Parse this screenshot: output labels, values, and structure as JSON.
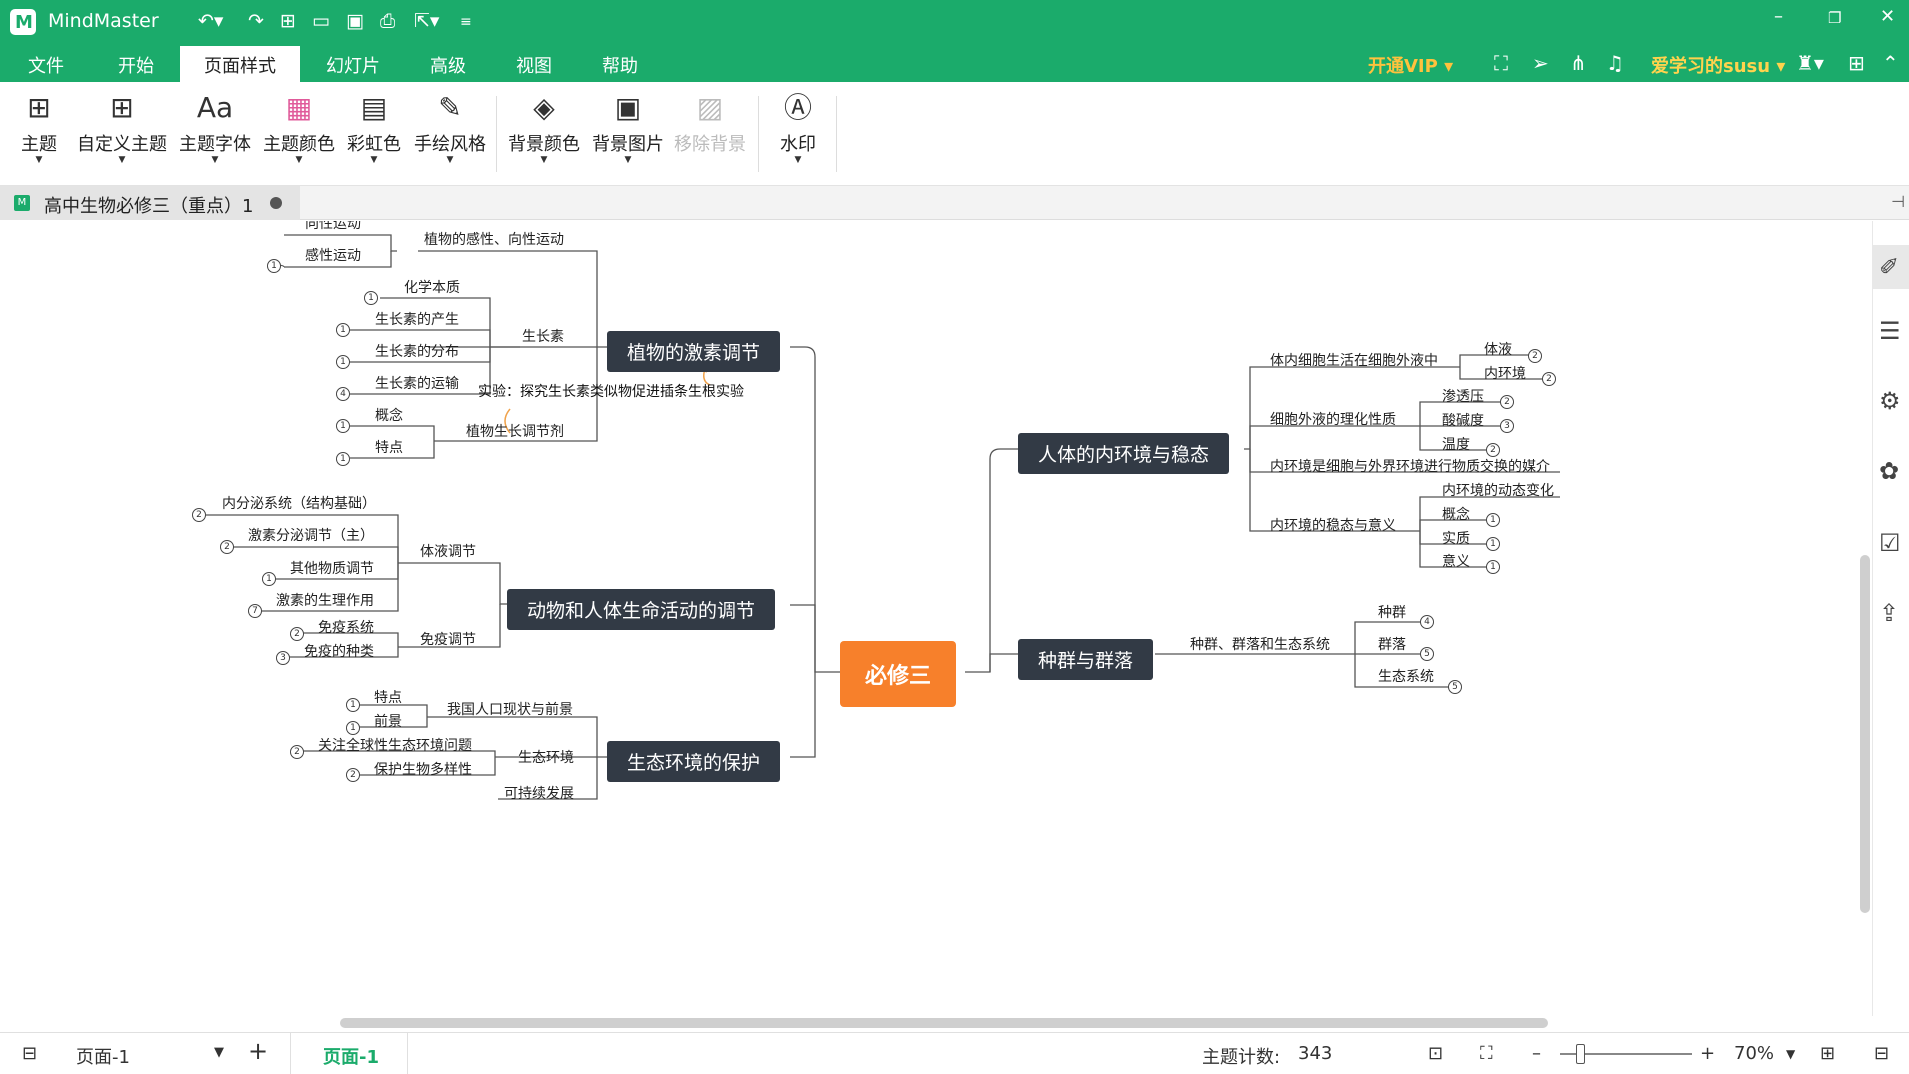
{
  "app": {
    "name": "MindMaster",
    "logo_letter": "M"
  },
  "menu": {
    "items": [
      "文件",
      "开始",
      "页面样式",
      "幻灯片",
      "高级",
      "视图",
      "帮助"
    ],
    "active": "页面样式",
    "vip": "开通VIP ▾",
    "user": "爱学习的susu ▾"
  },
  "ribbon": {
    "buttons": [
      {
        "label": "主题",
        "icon": "grid-icon",
        "glyph": "⊞"
      },
      {
        "label": "自定义主题",
        "icon": "custom-theme-icon",
        "glyph": "⊞"
      },
      {
        "label": "主题字体",
        "icon": "font-icon",
        "glyph": "Aa"
      },
      {
        "label": "主题颜色",
        "icon": "palette-icon",
        "glyph": "▦"
      },
      {
        "label": "彩虹色",
        "icon": "rainbow-icon",
        "glyph": "▤"
      },
      {
        "label": "手绘风格",
        "icon": "handdrawn-icon",
        "glyph": "✎"
      },
      {
        "label": "背景颜色",
        "icon": "paint-bucket-icon",
        "glyph": "◈"
      },
      {
        "label": "背景图片",
        "icon": "image-icon",
        "glyph": "▣"
      },
      {
        "label": "移除背景",
        "icon": "remove-background-icon",
        "glyph": "▨"
      },
      {
        "label": "水印",
        "icon": "watermark-icon",
        "glyph": "Ⓐ"
      }
    ]
  },
  "document": {
    "tab_title": "高中生物必修三（重点）1"
  },
  "mindmap": {
    "central": "必修三",
    "main_topics": [
      "植物的激素调节",
      "动物和人体生命活动的调节",
      "生态环境的保护",
      "人体的内环境与稳态",
      "种群与群落"
    ],
    "subtopics": {
      "plant": [
        "植物的感性、向性运动",
        "向性运动",
        "感性运动",
        "生长素",
        "化学本质",
        "生长素的产生",
        "生长素的分布",
        "生长素的运输",
        "植物生长调节剂",
        "概念",
        "特点"
      ],
      "plant_experiment": "实验：探究生长素类似物促进插条生根实验",
      "animal": [
        "体液调节",
        "内分泌系统（结构基础）",
        "激素分泌调节（主）",
        "其他物质调节",
        "激素的生理作用",
        "免疫调节",
        "免疫系统",
        "免疫的种类"
      ],
      "eco": [
        "我国人口现状与前景",
        "特点",
        "前景",
        "生态环境",
        "关注全球性生态环境问题",
        "保护生物多样性",
        "可持续发展"
      ],
      "internal": [
        "体内细胞生活在细胞外液中",
        "体液",
        "内环境",
        "细胞外液的理化性质",
        "渗透压",
        "酸碱度",
        "温度",
        "内环境是细胞与外界环境进行物质交换的媒介",
        "内环境的稳态与意义",
        "内环境的动态变化",
        "概念",
        "实质",
        "意义"
      ],
      "population": [
        "种群、群落和生态系统",
        "种群",
        "群落",
        "生态系统"
      ]
    },
    "badges": [
      "1",
      "1",
      "1",
      "1",
      "4",
      "1",
      "1",
      "2",
      "2",
      "1",
      "7",
      "2",
      "3",
      "1",
      "1",
      "2",
      "2",
      "2",
      "2",
      "2",
      "3",
      "2",
      "1",
      "1",
      "1",
      "4",
      "5",
      "5"
    ]
  },
  "status": {
    "page_select": "页面-1",
    "page_tab": "页面-1",
    "topic_count_label": "主题计数:",
    "topic_count": "343",
    "zoom": "70%"
  },
  "colors": {
    "brand": "#1bab6b",
    "central": "#f7802b",
    "main_node": "#323a45",
    "vip": "#ffc23d"
  }
}
